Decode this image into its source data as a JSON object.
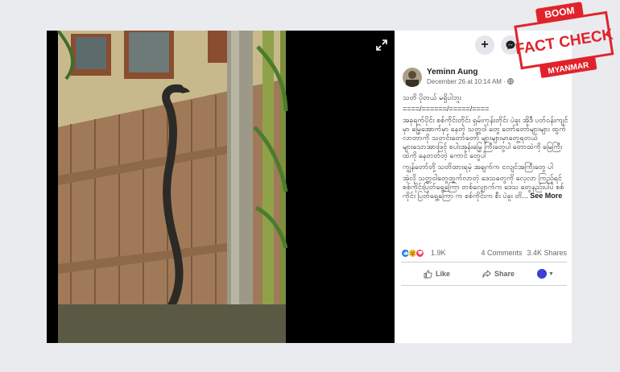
{
  "post": {
    "author": "Yeminn Aung",
    "date": "December 26 at 10:14 AM · ",
    "paragraphs": [
      "သတိ ပိုတယ် မရှိပါဘူး",
      "====/======/=====/====",
      "အခုရက်ပိုင်း စစ်ကိုင်းတိုင်း ရှမ်းကုန်းတိုင်း ပဲခူး အိုဒီ ပတ်ဝန်းကျင်မှာ မြွေအောက်မှာ နေတဲ့ သတ္တဝါ တွေ တော်တော်များများ ထွက်လာတာကို သတင်းတော်တော် များများမှာတွေ့ရတယ် များသောအားဖြင့် စပါးအုန်းမြွေ ကြီးတွေပါ တောထဲကို မြေကြီးထဲကို နေတတ်တဲ့ ကောင် တွေပါ",
      "ကျွန်တော်တို့ သတိထားရမဲ့ အချက်က ငလျင်အကြီးတွေ ပါ",
      "အဲ့လို သတ္တဝါတွေထွက်လာတဲ့ ဒေသတွေကို လေ့လာ ကြည့်ရင် စစ်ကိုင်းပြတ်ရွေ့ကြော တစ်လျှောက်က ဒေသ တွေနည်းပါပဲ စစ်ကိုင်း ပြတ်ရွေ့ကြော က စစ်ကိုင်းက စီး ပဲခူး တိ..."
    ],
    "see_more": "See More"
  },
  "stats": {
    "reactions_count": "1.9K",
    "comments": "4 Comments",
    "shares": "3.4K Shares"
  },
  "actions": {
    "like": "Like",
    "share": "Share"
  },
  "stamp": {
    "top": "BOOM",
    "main": "FACT CHECK",
    "bottom": "MYANMAR"
  },
  "colors": {
    "stamp_red": "#e0232b",
    "facebook_blue": "#1877f2"
  },
  "icons": [
    "expand-icon",
    "plus-icon",
    "messenger-icon",
    "globe-icon",
    "like-icon",
    "share-icon"
  ]
}
